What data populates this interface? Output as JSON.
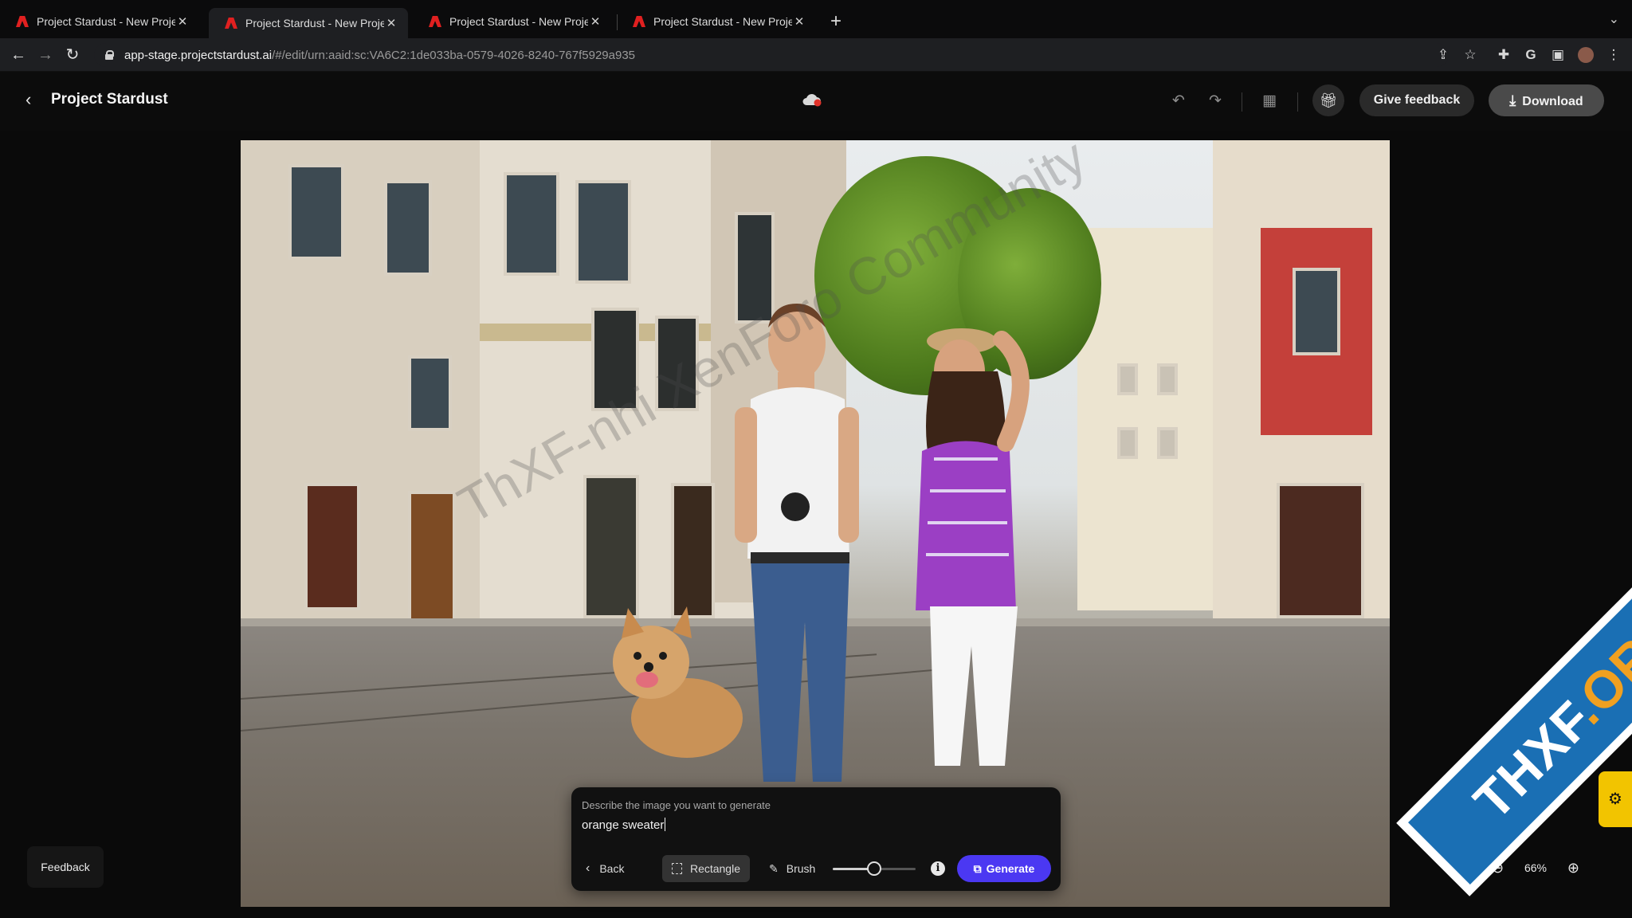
{
  "browser": {
    "tabs": [
      {
        "title": "Project Stardust - New Project"
      },
      {
        "title": "Project Stardust - New Project"
      },
      {
        "title": "Project Stardust - New Project"
      },
      {
        "title": "Project Stardust - New Project"
      }
    ],
    "active_tab": 1,
    "url_host": "app-stage.projectstardust.ai",
    "url_path": "/#/edit/urn:aaid:sc:VA6C2:1de033ba-0579-4026-8240-767f5929a935"
  },
  "app": {
    "title": "Project Stardust",
    "give_feedback_label": "Give feedback",
    "download_label": "Download",
    "cloud_status_color": "#e0322a"
  },
  "canvas": {
    "watermark": "ThXF-nhi XenForo Community"
  },
  "prompt": {
    "label": "Describe the image you want to generate",
    "value": "orange sweater",
    "back_label": "Back",
    "rectangle_label": "Rectangle",
    "brush_label": "Brush",
    "brush_size": 0.5,
    "generate_label": "Generate",
    "accent_color": "#4b38f2"
  },
  "floating": {
    "feedback_label": "Feedback",
    "zoom_level": "66%"
  },
  "badge": {
    "text_part1": "THXF",
    "text_part2": ".ORG"
  }
}
